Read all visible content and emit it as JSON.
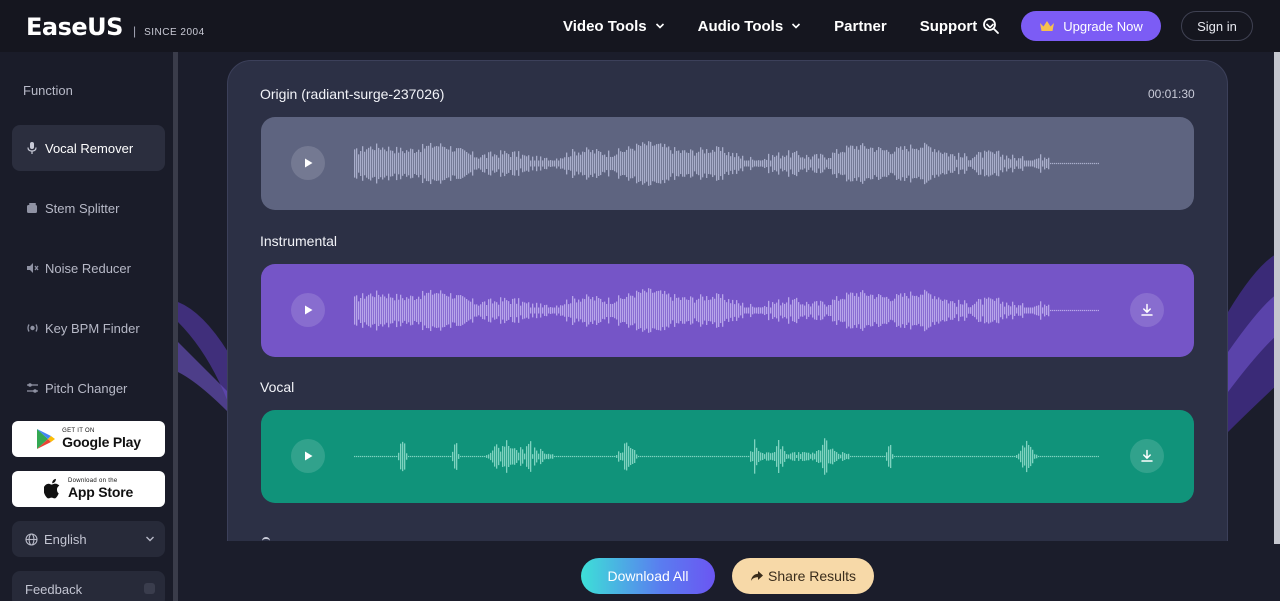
{
  "header": {
    "logo": "EaseUS",
    "since": "SINCE 2004",
    "nav": [
      {
        "label": "Video Tools",
        "has_dropdown": true
      },
      {
        "label": "Audio Tools",
        "has_dropdown": true
      },
      {
        "label": "Partner",
        "has_dropdown": false
      },
      {
        "label": "Support",
        "has_dropdown": true
      }
    ],
    "search_icon": "search-icon",
    "upgrade_label": "Upgrade Now",
    "signin_label": "Sign in"
  },
  "sidebar": {
    "title": "Function",
    "items": [
      {
        "label": "Vocal Remover",
        "icon": "microphone-icon",
        "active": true
      },
      {
        "label": "Stem Splitter",
        "icon": "stem-icon",
        "active": false
      },
      {
        "label": "Noise Reducer",
        "icon": "noise-icon",
        "active": false
      },
      {
        "label": "Key BPM Finder",
        "icon": "bpm-icon",
        "active": false
      },
      {
        "label": "Pitch Changer",
        "icon": "pitch-icon",
        "active": false
      }
    ],
    "google_play": {
      "small": "GET IT ON",
      "big": "Google Play"
    },
    "app_store": {
      "small": "Download on the",
      "big": "App Store"
    },
    "language": "English",
    "feedback": "Feedback"
  },
  "main": {
    "duration": "00:01:30",
    "tracks": [
      {
        "label": "Origin (radiant-surge-237026)",
        "color": "#5e6480"
      },
      {
        "label": "Instrumental",
        "color": "#7555c7"
      },
      {
        "label": "Vocal",
        "color": "#10937a"
      }
    ],
    "download_all": "Download All",
    "share_results": "Share Results"
  },
  "colors": {
    "accent": "#7c5cf5",
    "origin_track": "#5e6480",
    "instrumental_track": "#7555c7",
    "vocal_track": "#10937a",
    "share_button": "#f7d9a8"
  }
}
